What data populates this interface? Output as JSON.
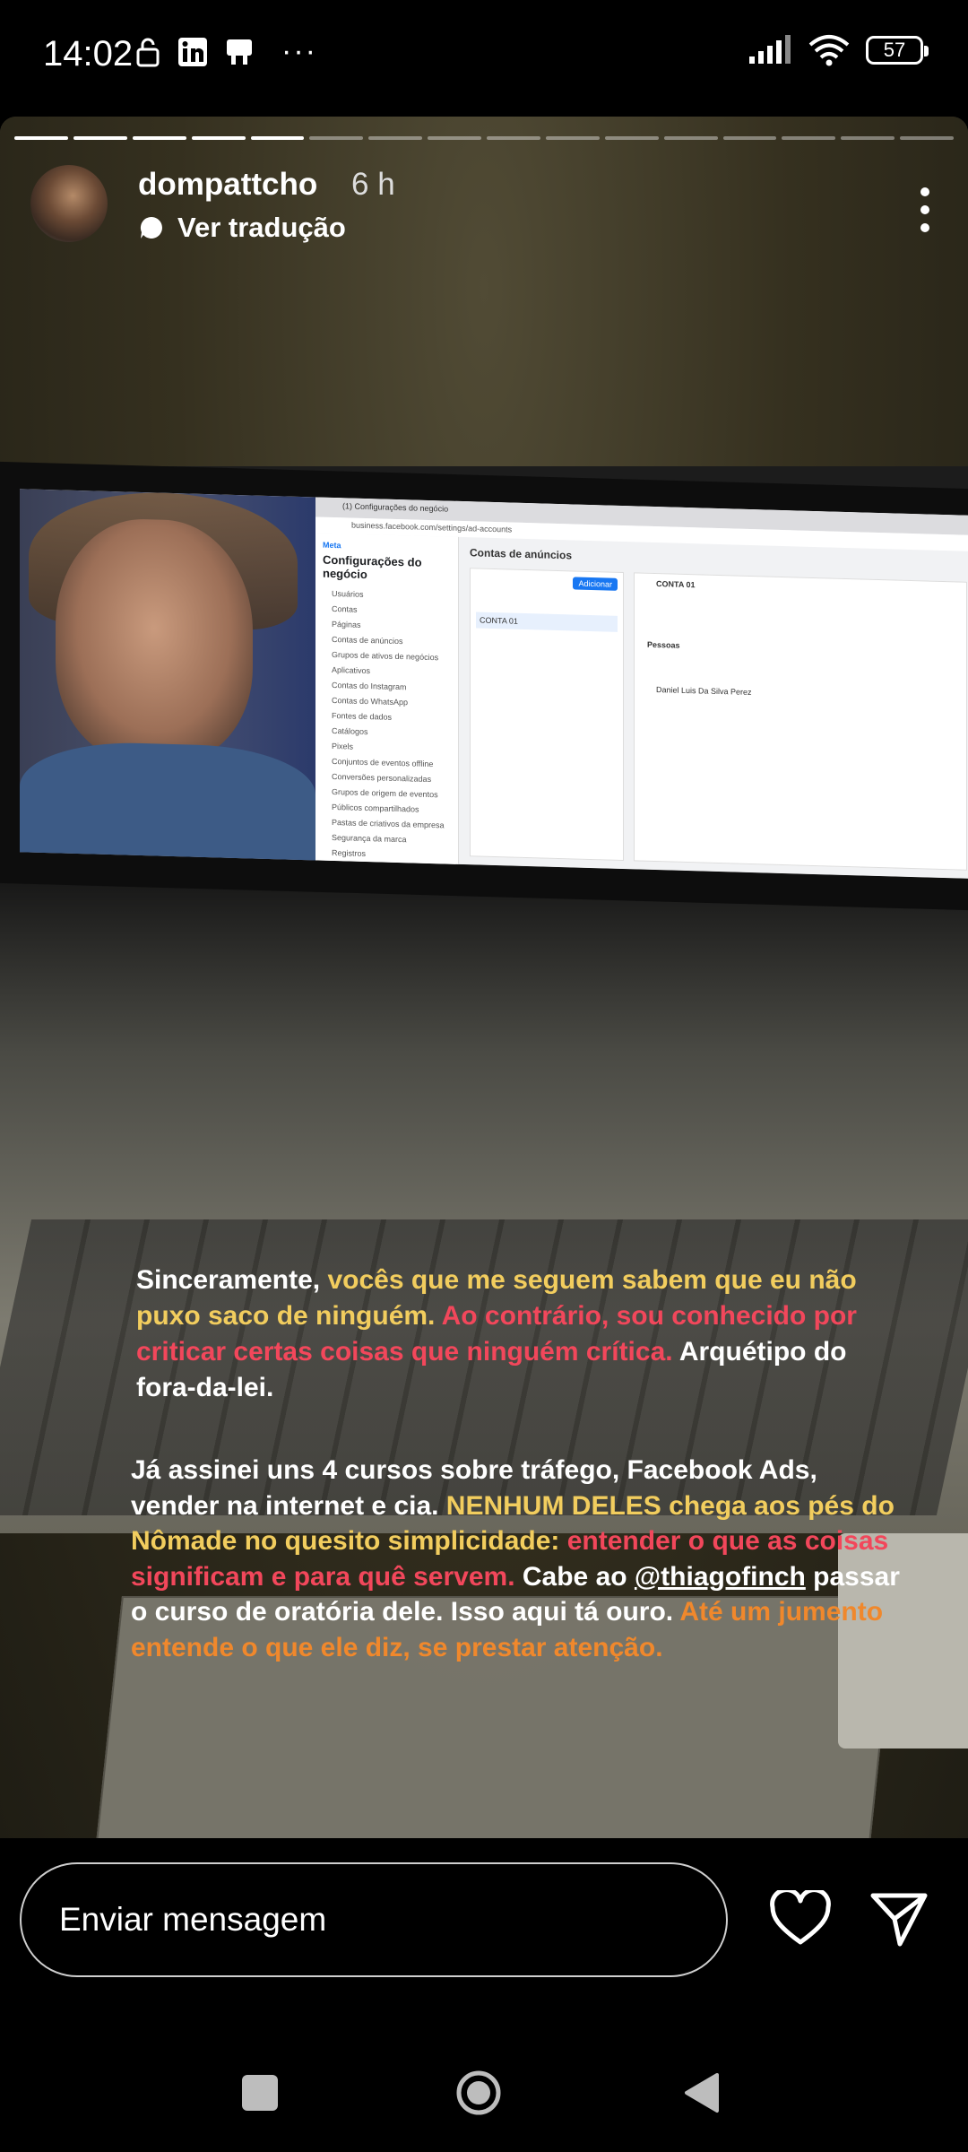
{
  "status_bar": {
    "time": "14:02",
    "left_icons": [
      "lock-icon",
      "linkedin-icon",
      "notification-icon",
      "more-dots-icon"
    ],
    "more_dots": "···",
    "right_icons": [
      "signal-icon",
      "wifi-icon"
    ],
    "battery": "57"
  },
  "story": {
    "progress_segments_total": 16,
    "progress_segments_done": 5,
    "username": "dompattcho",
    "time_ago": "6 h",
    "translate_label": "Ver tradução"
  },
  "screen_content": {
    "tab_title": "(1) Configurações do negócio",
    "url": "business.facebook.com/settings/ad-accounts",
    "brand": "Meta",
    "sidebar_title": "Configurações do negócio",
    "sidebar_items": [
      "Usuários",
      "Contas",
      "Páginas",
      "Contas de anúncios",
      "Grupos de ativos de negócios",
      "Aplicativos",
      "Contas do Instagram",
      "Contas do WhatsApp",
      "Fontes de dados",
      "Catálogos",
      "Pixels",
      "Conjuntos de eventos offline",
      "Conversões personalizadas",
      "Grupos de origem de eventos",
      "Públicos compartilhados",
      "Pastas de criativos da empresa",
      "Segurança da marca",
      "Registros"
    ],
    "main_title": "Contas de anúncios",
    "add_button": "Adicionar",
    "list_item": "CONTA 01",
    "panel_title": "CONTA 01",
    "people_title": "Pessoas",
    "person": "Daniel Luis Da Silva Perez"
  },
  "caption": {
    "p1": [
      {
        "text": "Sinceramente, ",
        "color": "white"
      },
      {
        "text": "vocês que me seguem sabem que eu não puxo saco de ninguém. ",
        "color": "yellow"
      },
      {
        "text": "Ao contrário, sou conhecido por criticar certas coisas que ninguém crítica. ",
        "color": "red"
      },
      {
        "text": "Arquétipo do fora-da-lei.",
        "color": "white"
      }
    ],
    "p2": [
      {
        "text": "Já assinei uns 4 cursos sobre tráfego, Facebook Ads, vender na internet e cia. ",
        "color": "white"
      },
      {
        "text": "NENHUM DELES chega aos pés do Nômade no quesito simplicidade: ",
        "color": "yellow"
      },
      {
        "text": "entender o que as coisas significam e para quê servem. ",
        "color": "red"
      },
      {
        "text": "Cabe ao ",
        "color": "white"
      },
      {
        "text": "@thiagofinch",
        "color": "mention"
      },
      {
        "text": " passar o curso de oratória dele. Isso aqui tá ouro. ",
        "color": "white"
      },
      {
        "text": "Até um jumento entende o que ele diz, se prestar atenção.",
        "color": "orange"
      }
    ]
  },
  "reply": {
    "placeholder": "Enviar mensagem"
  },
  "colors": {
    "white": "#ffffff",
    "yellow": "#f2cd5e",
    "red": "#f2475b",
    "orange": "#f0882c"
  }
}
